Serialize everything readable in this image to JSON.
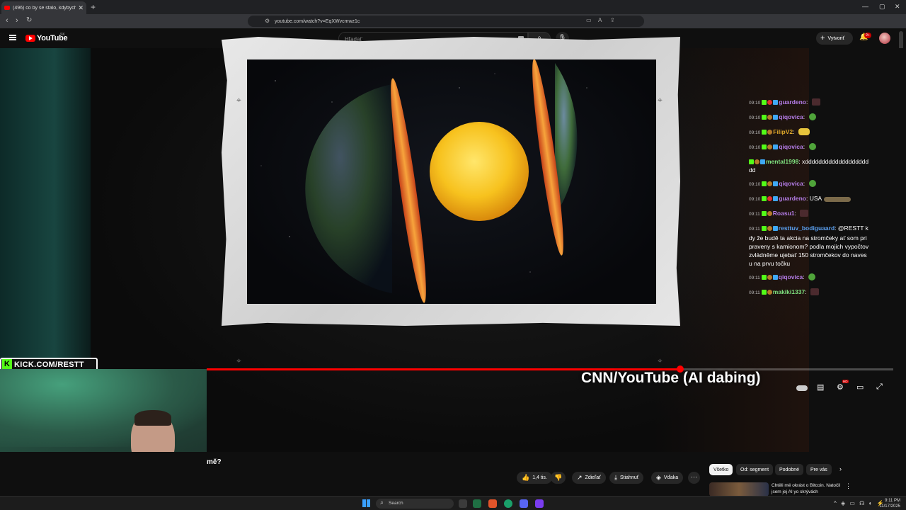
{
  "browser": {
    "tab_title": "(496) co by se stalo, kdybych",
    "new_tab": "+",
    "url": "youtube.com/watch?v=EqXWvcmwz1c",
    "win_controls": [
      "—",
      "▢",
      "✕"
    ]
  },
  "youtube": {
    "logo": "YouTube",
    "region": "SK",
    "search_placeholder": "Hľadať",
    "create_label": "Vytvoriť",
    "notif_count": "9+"
  },
  "video": {
    "overlay_caption": "CNN/YouTube (AI dabing)",
    "kick_label": "KICK.COM/RESTT",
    "progress_fraction": 0.69
  },
  "chat": [
    {
      "time": "09:10",
      "badges": [
        "k",
        "r",
        "s"
      ],
      "user": "guardeno",
      "color": "#b57de8",
      "text": "",
      "emote": "box"
    },
    {
      "time": "09:10",
      "badges": [
        "k",
        "g",
        "s"
      ],
      "user": "qiqovica",
      "color": "#b57de8",
      "text": "",
      "emote": "ok"
    },
    {
      "time": "09:10",
      "badges": [
        "k",
        "g"
      ],
      "user": "FilipV2",
      "color": "#e0a92a",
      "text": "",
      "emote": "dog"
    },
    {
      "time": "09:10",
      "badges": [
        "k",
        "g",
        "s"
      ],
      "user": "qiqovica",
      "color": "#b57de8",
      "text": "",
      "emote": "ok"
    },
    {
      "time": "",
      "badges": [
        "k",
        "g",
        "s"
      ],
      "user": "mental1998",
      "color": "#7fe07f",
      "text": "xddddddddddddddddddddd",
      "emote": ""
    },
    {
      "time": "09:10",
      "badges": [
        "k",
        "g",
        "s"
      ],
      "user": "qiqovica",
      "color": "#b57de8",
      "text": "",
      "emote": "ok"
    },
    {
      "time": "09:10",
      "badges": [
        "k",
        "r",
        "s"
      ],
      "user": "guardeno",
      "color": "#b57de8",
      "text": "USA",
      "emote": "wide"
    },
    {
      "time": "09:11",
      "badges": [
        "k",
        "g"
      ],
      "user": "Roasu1",
      "color": "#b57de8",
      "text": "",
      "emote": "box"
    },
    {
      "time": "09:11",
      "badges": [
        "k",
        "g",
        "s"
      ],
      "user": "resttuv_bodiguaard",
      "color": "#5aa0f0",
      "text": "@RESTT kdy že budě ta akcia na stromčeky ať som pripraveny s kamionom? podla mojich vypočtov zvládněme ujebať 150 stromčekov do navesu na prvu točku",
      "emote": ""
    },
    {
      "time": "09:11",
      "badges": [
        "k",
        "g",
        "s"
      ],
      "user": "qiqovica",
      "color": "#b57de8",
      "text": "",
      "emote": "ok"
    },
    {
      "time": "09:11",
      "badges": [
        "k",
        "g"
      ],
      "user": "makiki1337",
      "color": "#7fe07f",
      "text": "",
      "emote": "box"
    }
  ],
  "below": {
    "title_fragment": "mě?",
    "like_count": "1,4 tis.",
    "share": "Zdieľať",
    "download": "Stiahnuť",
    "thanks": "Vďaka",
    "more": "⋯",
    "chips": [
      "Všetko",
      "Od: segment",
      "Podobné",
      "Pre vás"
    ],
    "rec_title": "Chtěli mě okrást o Bitcoin. Natočil jsem jej AI yo skrývách"
  },
  "taskbar": {
    "search": "Search",
    "time": "9:11 PM",
    "date": "11/17/2025"
  }
}
